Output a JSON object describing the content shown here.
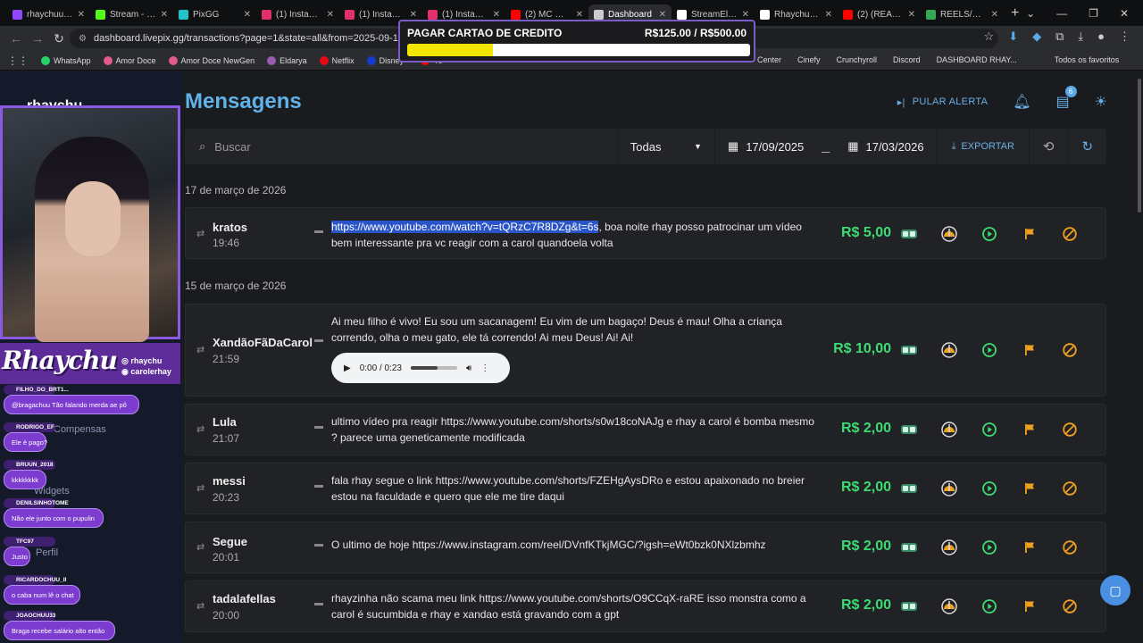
{
  "browser": {
    "tabs": [
      {
        "title": "rhaychuu - T",
        "color": "#9146ff",
        "active": false
      },
      {
        "title": "Stream - Kick",
        "color": "#53fc18",
        "active": false
      },
      {
        "title": "PixGG",
        "color": "#22c3c9",
        "active": false
      },
      {
        "title": "(1) Instagram",
        "color": "#e1306c",
        "active": false
      },
      {
        "title": "(1) Instagram",
        "color": "#e1306c",
        "active": false
      },
      {
        "title": "(1) Instagram",
        "color": "#e1306c",
        "active": false
      },
      {
        "title": "(2) MC MAG",
        "color": "#ff0000",
        "active": false
      },
      {
        "title": "Dashboard",
        "color": "#cccccc",
        "active": true
      },
      {
        "title": "StreamElem",
        "color": "#ffffff",
        "active": false
      },
      {
        "title": "Rhaychuchu",
        "color": "#ffffff",
        "active": false
      },
      {
        "title": "(2) (REACT)",
        "color": "#ff0000",
        "active": false
      },
      {
        "title": "REELS/SHOR",
        "color": "#34a853",
        "active": false
      }
    ],
    "url": "dashboard.livepix.gg/transactions?page=1&state=all&from=2025-09-17T00%3A0",
    "bookmarks": [
      {
        "label": "WhatsApp",
        "color": "#25d366"
      },
      {
        "label": "Amor Doce",
        "color": "#e05a8a"
      },
      {
        "label": "Amor Doce NewGen",
        "color": "#e05a8a"
      },
      {
        "label": "Eldarya",
        "color": "#9b59b6"
      },
      {
        "label": "Netflix",
        "color": "#e50914"
      },
      {
        "label": "Disney+",
        "color": "#113ccf"
      },
      {
        "label": "Yo",
        "color": "#ff0000"
      }
    ],
    "bookmarks_right": [
      "Center",
      "Cinefy",
      "Crunchyroll",
      "Discord",
      "DASHBOARD RHAY...",
      "Todos os favoritos"
    ]
  },
  "goal": {
    "title": "PAGAR CARTAO DE CREDITO",
    "amount": "R$125.00 / R$500.00",
    "progress": 0.25
  },
  "overlay": {
    "logo": "Rhaychu",
    "handles": [
      "rhaychu",
      "carolerhay"
    ],
    "sidebar_ghost": [
      "rhaychu",
      "Compensas",
      "Widgets",
      "Perfil"
    ],
    "chat": [
      {
        "user": "FILHO_DO_BRT1...",
        "msg": "@bragachuu Tão falando merda ae pô"
      },
      {
        "user": "RODRIGO_EF",
        "msg": "Ele é pago?"
      },
      {
        "user": "BRUUN_2018",
        "msg": "kkkkkkkk"
      },
      {
        "user": "DENILSINHOTOME",
        "msg": "Não ele junto com o pupulin"
      },
      {
        "user": "TFC97",
        "msg": "Justo"
      },
      {
        "user": "RICARDOCHUU_II",
        "msg": "o caba num lê o chat"
      },
      {
        "user": "JOAOCHUU33",
        "msg": "Braga recebe salário alto então"
      }
    ]
  },
  "page": {
    "title": "Mensagens",
    "skip_alert": "PULAR ALERTA",
    "notifications_badge": "6"
  },
  "filters": {
    "search_placeholder": "Buscar",
    "state": "Todas",
    "date_from": "17/09/2025",
    "date_sep": "_",
    "date_to": "17/03/2026",
    "export": "EXPORTAR"
  },
  "groups": [
    {
      "label": "17 de março de 2026"
    },
    {
      "label": "15 de março de 2026"
    }
  ],
  "transactions": [
    {
      "name": "kratos",
      "time": "19:46",
      "link": "https://www.youtube.com/watch?v=tQRzC7R8DZg&t=6s",
      "message": ", boa noite rhay posso patrocinar um vídeo bem interessante pra vc reagir com a carol quandoela volta",
      "amount": "R$ 5,00"
    },
    {
      "name": "XandãoFãDaCarol",
      "time": "21:59",
      "message": "Ai meu filho é vivo! Eu sou um sacanagem! Eu vim de um bagaço! Deus é mau! Olha a criança correndo, olha o meu gato, ele tá correndo! Ai meu Deus! Ai! Ai!",
      "amount": "R$ 10,00",
      "audio": "0:00 / 0:23"
    },
    {
      "name": "Lula",
      "time": "21:07",
      "message": "ultimo vídeo pra reagir https://www.youtube.com/shorts/s0w18coNAJg e rhay a carol é bomba mesmo ? parece uma geneticamente modificada",
      "amount": "R$ 2,00"
    },
    {
      "name": "messi",
      "time": "20:23",
      "message": "fala rhay segue o link https://www.youtube.com/shorts/FZEHgAysDRo e estou apaixonado no breier estou na faculdade e quero que ele me tire daqui",
      "amount": "R$ 2,00"
    },
    {
      "name": "Segue",
      "time": "20:01",
      "message": "O ultimo de hoje https://www.instagram.com/reel/DVnfKTkjMGC/?igsh=eWt0bzk0NXlzbmhz",
      "amount": "R$ 2,00"
    },
    {
      "name": "tadalafellas",
      "time": "20:00",
      "message": "rhayzinha não scama meu link https://www.youtube.com/shorts/O9CCqX-raRE isso monstra como a carol é sucumbida e rhay e xandao está gravando com a gpt",
      "amount": "R$ 2,00"
    }
  ]
}
